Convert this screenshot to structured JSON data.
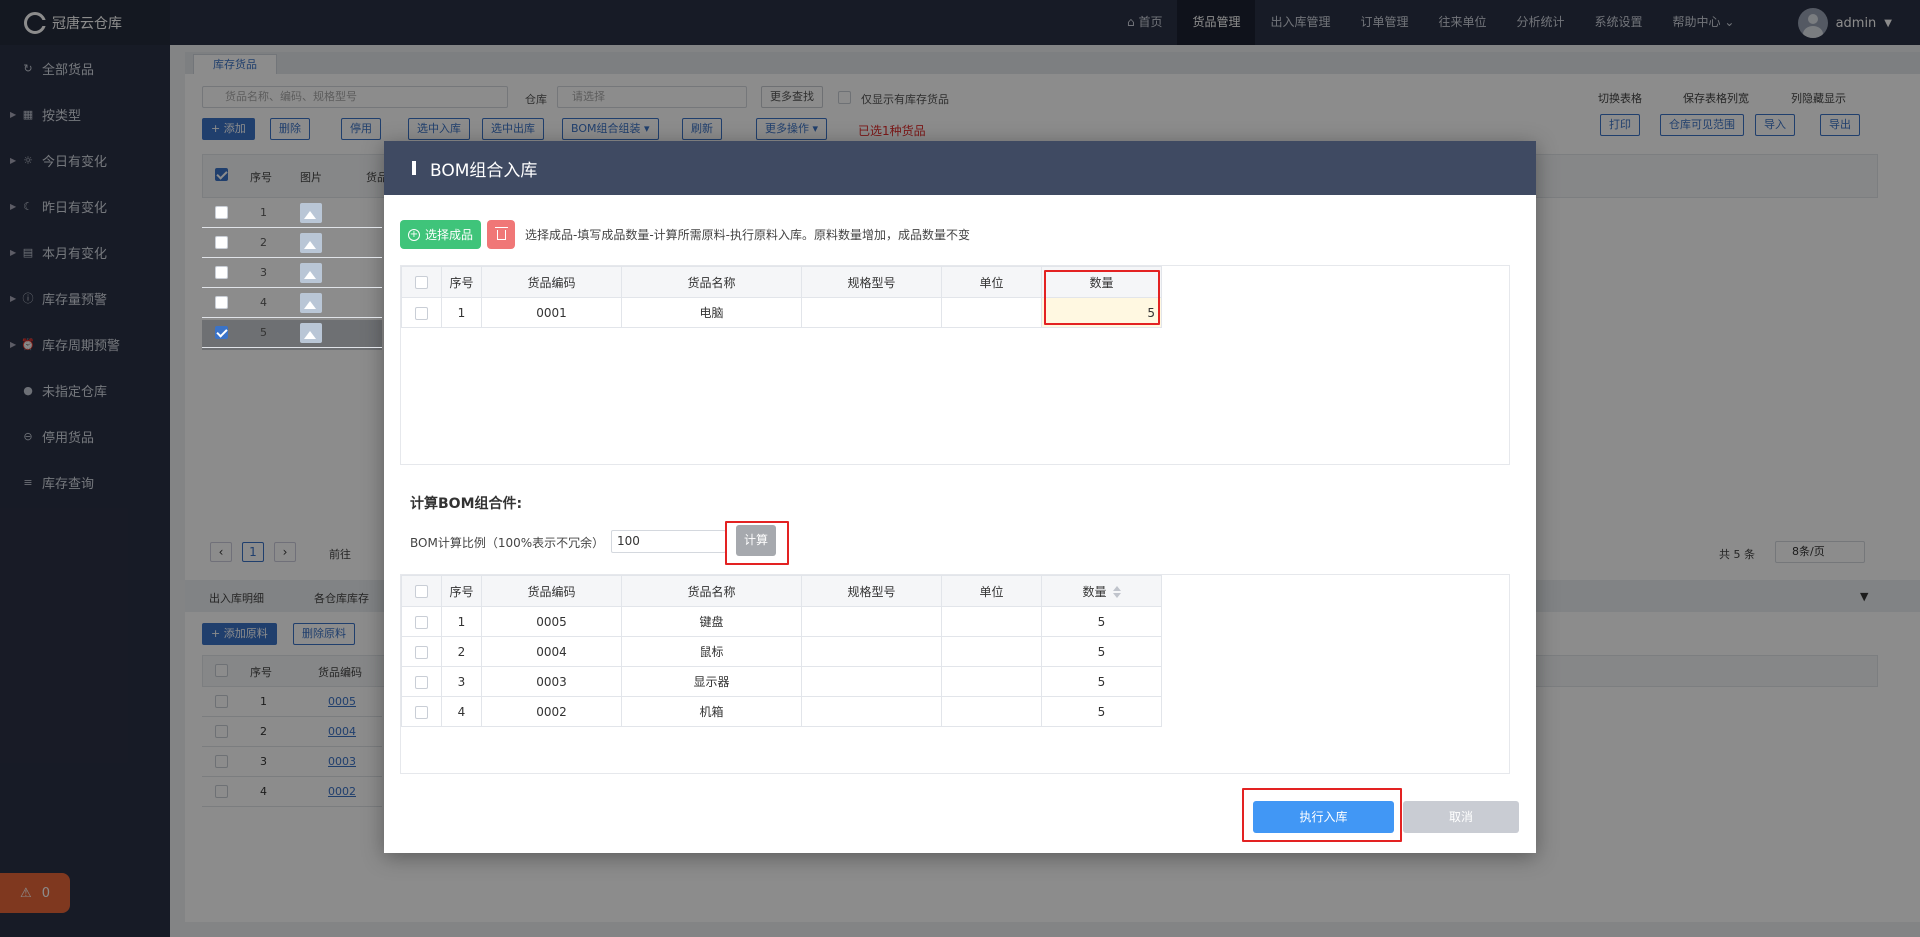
{
  "app": {
    "brand": "冠唐云仓库"
  },
  "sidebar": {
    "items": [
      {
        "label": "全部货品",
        "icon": "refresh-icon",
        "glyph": "↻",
        "arrow": false
      },
      {
        "label": "按类型",
        "icon": "grid-icon",
        "glyph": "▦",
        "arrow": true
      },
      {
        "label": "今日有变化",
        "icon": "sun-icon",
        "glyph": "☼",
        "arrow": true
      },
      {
        "label": "昨日有变化",
        "icon": "moon-icon",
        "glyph": "☾",
        "arrow": true
      },
      {
        "label": "本月有变化",
        "icon": "calendar-icon",
        "glyph": "▤",
        "arrow": true
      },
      {
        "label": "库存量预警",
        "icon": "warning-icon",
        "glyph": "ⓘ",
        "arrow": true
      },
      {
        "label": "库存周期预警",
        "icon": "alarm-clock-icon",
        "glyph": "⏰",
        "arrow": true
      },
      {
        "label": "未指定仓库",
        "icon": "question-icon",
        "glyph": "●",
        "arrow": false
      },
      {
        "label": "停用货品",
        "icon": "stop-icon",
        "glyph": "⊖",
        "arrow": false
      },
      {
        "label": "库存查询",
        "icon": "list-icon",
        "glyph": "≡",
        "arrow": false
      }
    ],
    "alarm_count": "0"
  },
  "topnav": {
    "items": [
      "首页",
      "货品管理",
      "出入库管理",
      "订单管理",
      "往来单位",
      "分析统计",
      "系统设置",
      "帮助中心"
    ],
    "active_index": 1,
    "user": "admin"
  },
  "background": {
    "tab": "库存货品",
    "search_placeholder": "货品名称、编码、规格型号",
    "warehouse_label": "仓库",
    "warehouse_placeholder": "请选择",
    "more_search": "更多查找",
    "only_stock": "仅显示有库存货品",
    "buttons": [
      "+ 添加",
      "删除",
      "停用",
      "选中入库",
      "选中出库",
      "BOM组合组装 ▾",
      "刷新",
      "更多操作 ▾"
    ],
    "selected_text": "已选1种货品",
    "right_links": [
      "切换表格",
      "保存表格列宽",
      "列隐藏显示"
    ],
    "right_buttons": [
      "打印",
      "仓库可见范围",
      "导入",
      "导出"
    ],
    "table_headers": [
      "序号",
      "图片",
      "货品"
    ],
    "rows": [
      "1",
      "2",
      "3",
      "4",
      "5"
    ],
    "pagination": {
      "goto": "前往",
      "page": "1",
      "total": "共 5 条",
      "per_page": "8条/页"
    },
    "bottom_tabs": [
      "出入库明细",
      "各仓库库存"
    ],
    "bottom_buttons": [
      "+ 添加原料",
      "删除原料"
    ],
    "bottom_headers": [
      "序号",
      "货品编码"
    ],
    "bottom_rows": [
      {
        "no": "1",
        "code": "0005"
      },
      {
        "no": "2",
        "code": "0004"
      },
      {
        "no": "3",
        "code": "0003"
      },
      {
        "no": "4",
        "code": "0002"
      }
    ]
  },
  "modal": {
    "title": "BOM组合入库",
    "select_button": "选择成品",
    "hint": "选择成品-填写成品数量-计算所需原料-执行原料入库。原料数量增加，成品数量不变",
    "columns": [
      "序号",
      "货品编码",
      "货品名称",
      "规格型号",
      "单位",
      "数量"
    ],
    "product_rows": [
      {
        "no": "1",
        "code": "0001",
        "name": "电脑",
        "spec": "",
        "unit": "",
        "qty": "5"
      }
    ],
    "calc_title": "计算BOM组合件:",
    "calc_label": "BOM计算比例（100%表示不冗余）",
    "calc_value": "100",
    "calc_button": "计算",
    "material_rows": [
      {
        "no": "1",
        "code": "0005",
        "name": "键盘",
        "spec": "",
        "unit": "",
        "qty": "5"
      },
      {
        "no": "2",
        "code": "0004",
        "name": "鼠标",
        "spec": "",
        "unit": "",
        "qty": "5"
      },
      {
        "no": "3",
        "code": "0003",
        "name": "显示器",
        "spec": "",
        "unit": "",
        "qty": "5"
      },
      {
        "no": "4",
        "code": "0002",
        "name": "机箱",
        "spec": "",
        "unit": "",
        "qty": "5"
      }
    ],
    "execute_button": "执行入库",
    "cancel_button": "取消"
  }
}
